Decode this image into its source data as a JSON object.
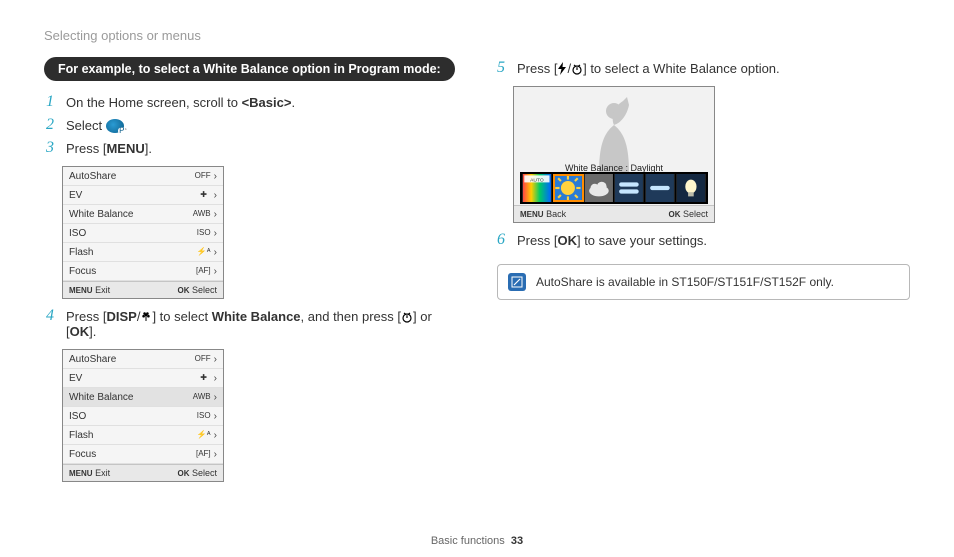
{
  "header": "Selecting options or menus",
  "pill": "For example, to select a White Balance option in Program mode:",
  "steps": {
    "s1": {
      "num": "1",
      "pre": "On the Home screen, scroll to ",
      "bold": "<Basic>",
      "post": "."
    },
    "s2": {
      "num": "2",
      "label": "Select"
    },
    "s3": {
      "num": "3",
      "pre": "Press [",
      "btn": "MENU",
      "post": "]."
    },
    "s4": {
      "num": "4",
      "pre": "Press [",
      "btn1": "DISP",
      "slash": "/",
      "btn2_icon": "flower",
      "mid": "] to select ",
      "bold": "White Balance",
      "mid2": ", and then press [",
      "timer_icon": "timer",
      "post": "] or [",
      "ok": "OK",
      "post2": "]."
    },
    "s5": {
      "num": "5",
      "pre": "Press [",
      "flash_icon": "flash",
      "slash": "/",
      "timer_icon": "timer",
      "post": "] to select a White Balance option."
    },
    "s6": {
      "num": "6",
      "pre": "Press [",
      "ok": "OK",
      "post": "] to save your settings."
    }
  },
  "menu": {
    "rows": [
      {
        "name": "AutoShare",
        "icon": "OFF"
      },
      {
        "name": "EV",
        "icon": "✚"
      },
      {
        "name": "White Balance",
        "icon": "AWB"
      },
      {
        "name": "ISO",
        "icon": "ISO"
      },
      {
        "name": "Flash",
        "icon": "⚡ᴬ"
      },
      {
        "name": "Focus",
        "icon": "[AF]"
      }
    ],
    "exit_btn": "MENU",
    "exit": "Exit",
    "select_btn": "OK",
    "select": "Select",
    "active_index_A": -1,
    "active_index_B": 2
  },
  "preview": {
    "label": "White Balance : Daylight",
    "back_btn": "MENU",
    "back": "Back",
    "select_btn": "OK",
    "select": "Select",
    "thumbs": [
      "auto",
      "daylight",
      "cloudy",
      "fluor_w",
      "fluor_n",
      "tungsten"
    ],
    "selected": 1,
    "auto_label": "AUTO"
  },
  "note": {
    "text": "AutoShare is available in ST150F/ST151F/ST152F only."
  },
  "footer": {
    "section": "Basic functions",
    "page": "33"
  }
}
